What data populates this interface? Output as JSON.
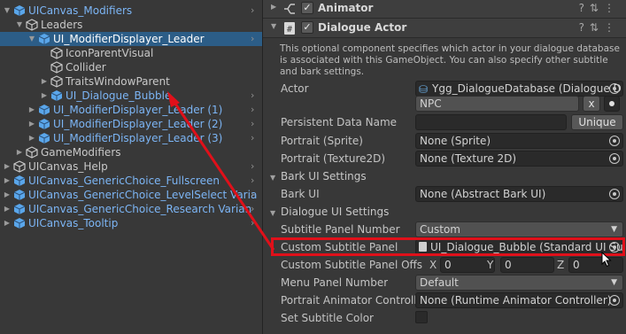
{
  "hierarchy": {
    "items": [
      {
        "label": "UICanvas_Modifiers",
        "indent": 0,
        "expanded": true,
        "color": "blue",
        "chevron": true
      },
      {
        "label": "Leaders",
        "indent": 1,
        "expanded": true,
        "color": "normal",
        "chevron": false
      },
      {
        "label": "UI_ModifierDisplayer_Leader",
        "indent": 2,
        "expanded": true,
        "color": "selected",
        "chevron": true,
        "selected": true
      },
      {
        "label": "IconParentVisual",
        "indent": 3,
        "expanded": null,
        "color": "normal",
        "chevron": false
      },
      {
        "label": "Collider",
        "indent": 3,
        "expanded": null,
        "color": "normal",
        "chevron": false
      },
      {
        "label": "TraitsWindowParent",
        "indent": 3,
        "expanded": false,
        "color": "normal",
        "chevron": false
      },
      {
        "label": "UI_Dialogue_Bubble",
        "indent": 3,
        "expanded": false,
        "color": "blue",
        "chevron": true
      },
      {
        "label": "UI_ModifierDisplayer_Leader (1)",
        "indent": 2,
        "expanded": false,
        "color": "blue",
        "chevron": true
      },
      {
        "label": "UI_ModifierDisplayer_Leader (2)",
        "indent": 2,
        "expanded": false,
        "color": "blue",
        "chevron": true
      },
      {
        "label": "UI_ModifierDisplayer_Leader (3)",
        "indent": 2,
        "expanded": false,
        "color": "blue",
        "chevron": true
      },
      {
        "label": "GameModifiers",
        "indent": 1,
        "expanded": false,
        "color": "normal",
        "chevron": false
      },
      {
        "label": "UICanvas_Help",
        "indent": 0,
        "expanded": false,
        "color": "normal",
        "chevron": true
      },
      {
        "label": "UICanvas_GenericChoice_Fullscreen",
        "indent": 0,
        "expanded": false,
        "color": "blue",
        "chevron": true
      },
      {
        "label": "UICanvas_GenericChoice_LevelSelect Varia",
        "indent": 0,
        "expanded": false,
        "color": "blue",
        "chevron": true
      },
      {
        "label": "UICanvas_GenericChoice_Research Varian",
        "indent": 0,
        "expanded": false,
        "color": "blue",
        "chevron": true
      },
      {
        "label": "UICanvas_Tooltip",
        "indent": 0,
        "expanded": false,
        "color": "blue",
        "chevron": true
      }
    ]
  },
  "inspector": {
    "animator": {
      "title": "Animator",
      "enabled": true
    },
    "dialogue_actor": {
      "title": "Dialogue Actor",
      "enabled": true,
      "description": "This optional component specifies which actor in your dialogue database is associated with this GameObject. You can also specify other subtitle and bark settings.",
      "actor_label": "Actor",
      "actor_database": "Ygg_DialogueDatabase (Dialogue D",
      "actor_value": "NPC",
      "actor_clear_button": "x",
      "persistent_label": "Persistent Data Name",
      "persistent_value": "",
      "unique_button": "Unique",
      "portrait_sprite_label": "Portrait (Sprite)",
      "portrait_sprite_value": "None (Sprite)",
      "portrait_tex_label": "Portrait (Texture2D)",
      "portrait_tex_value": "None (Texture 2D)",
      "bark_section": "Bark UI Settings",
      "bark_ui_label": "Bark UI",
      "bark_ui_value": "None (Abstract Bark UI)",
      "dialogue_section": "Dialogue UI Settings",
      "subtitle_panel_number_label": "Subtitle Panel Number",
      "subtitle_panel_number_value": "Custom",
      "custom_subtitle_panel_label": "Custom Subtitle Panel",
      "custom_subtitle_panel_value": "UI_Dialogue_Bubble (Standard UI Su",
      "custom_subtitle_offset_label": "Custom Subtitle Panel Offs",
      "offset_x_label": "X",
      "offset_x": "0",
      "offset_y_label": "Y",
      "offset_y": "0",
      "offset_z_label": "Z",
      "offset_z": "0",
      "menu_panel_number_label": "Menu Panel Number",
      "menu_panel_number_value": "Default",
      "portrait_animator_label": "Portrait Animator Controller",
      "portrait_animator_value": "None (Runtime Animator Controller)",
      "set_subtitle_color_label": "Set Subtitle Color",
      "set_subtitle_color": false
    }
  },
  "colors": {
    "background": "#383838",
    "selection": "#2c5d87",
    "prefab_blue": "#7cb5f5",
    "annotation_red": "#e0101a"
  }
}
